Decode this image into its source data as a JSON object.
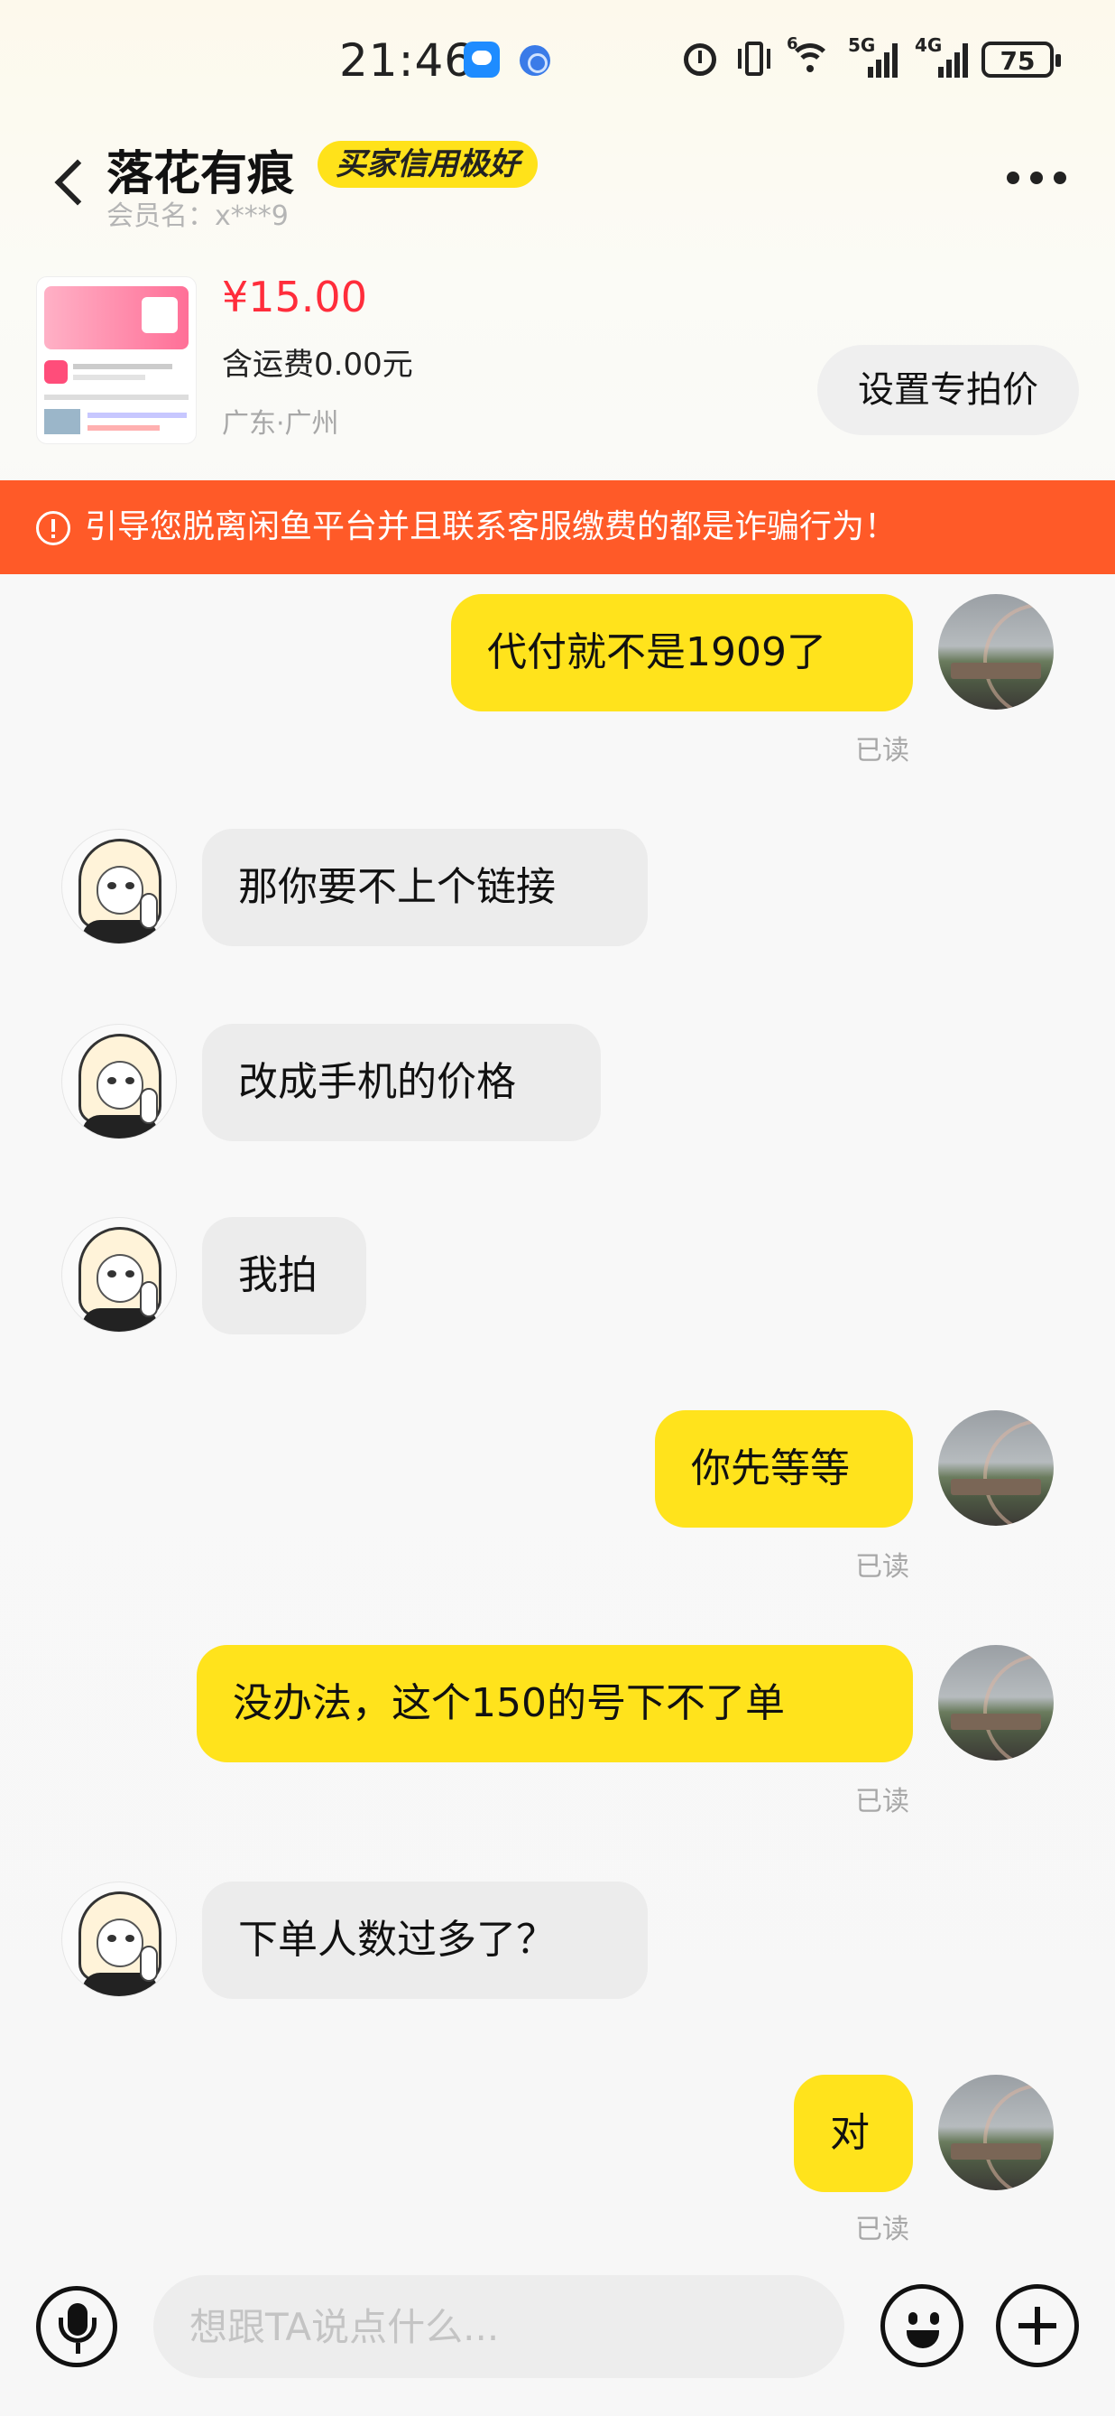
{
  "status_bar": {
    "time": "21:46",
    "network_5g": "5G",
    "network_4g": "4G",
    "wifi_label": "6",
    "battery": "75"
  },
  "header": {
    "name": "落花有痕",
    "badge": "买家信用极好",
    "member_label": "会员名：",
    "member_id": "x***9"
  },
  "product": {
    "price": "¥15.00",
    "shipping": "含运费0.00元",
    "location": "广东·广州",
    "special_price_button": "设置专拍价"
  },
  "warning": {
    "text": "引导您脱离闲鱼平台并且联系客服缴费的都是诈骗行为！"
  },
  "messages": [
    {
      "sender": "me",
      "text": "代付就不是1909了",
      "status": "已读"
    },
    {
      "sender": "other",
      "text": "那你要不上个链接"
    },
    {
      "sender": "other",
      "text": "改成手机的价格"
    },
    {
      "sender": "other",
      "text": "我拍"
    },
    {
      "sender": "me",
      "text": "你先等等",
      "status": "已读"
    },
    {
      "sender": "me",
      "text": "没办法，这个150的号下不了单",
      "status": "已读"
    },
    {
      "sender": "other",
      "text": "下单人数过多了？"
    },
    {
      "sender": "me",
      "text": "对",
      "status": "已读"
    }
  ],
  "input": {
    "placeholder": "想跟TA说点什么..."
  },
  "icons": [
    "back-icon",
    "more-icon",
    "alarm-icon",
    "vibrate-icon",
    "wifi-icon",
    "signal-icon",
    "battery-icon",
    "warning-icon",
    "microphone-icon",
    "emoji-icon",
    "plus-icon"
  ],
  "colors": {
    "accent_yellow": "#ffe31c",
    "price_red": "#ff2d3b",
    "warning_orange": "#ff5a28",
    "incoming_bubble": "#ececec"
  }
}
